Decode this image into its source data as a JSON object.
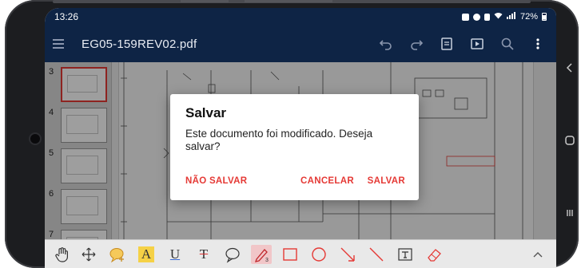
{
  "status_bar": {
    "time": "13:26",
    "battery": "72%",
    "icons": [
      "notification-icon",
      "alarm-icon",
      "mute-icon",
      "wifi-icon",
      "signal-icon",
      "battery-icon"
    ]
  },
  "app_bar": {
    "file_name": "EG05-159REV02.pdf",
    "actions": [
      "undo-icon",
      "redo-icon",
      "pages-view-icon",
      "presentation-icon",
      "search-icon",
      "more-vert-icon"
    ]
  },
  "thumbnails": {
    "pages": [
      "3",
      "4",
      "5",
      "6",
      "7"
    ],
    "active_page": "3"
  },
  "dialog": {
    "title": "Salvar",
    "message": "Este documento foi modificado. Deseja salvar?",
    "buttons": {
      "dont_save": "NÃO SALVAR",
      "cancel": "CANCELAR",
      "save": "SALVAR"
    }
  },
  "toolbar": {
    "tools": [
      "hand-icon",
      "move-icon",
      "comment-add-icon",
      "highlight-text-icon",
      "underline-icon",
      "strikethrough-icon",
      "comment-icon",
      "pen-icon",
      "rectangle-icon",
      "ellipse-icon",
      "arrow-icon",
      "line-icon",
      "text-box-icon",
      "eraser-icon",
      "chevron-up-icon"
    ],
    "highlight_letter": "A",
    "underline_letter": "U",
    "strike_letter": "T",
    "pen_badge": "3",
    "selected_tool": "pen-icon"
  },
  "system_nav": [
    "back-icon",
    "home-icon",
    "recents-icon"
  ],
  "colors": {
    "app_bar": "#0e2445",
    "accent": "#e53935",
    "dialog_bg": "#ffffff"
  }
}
